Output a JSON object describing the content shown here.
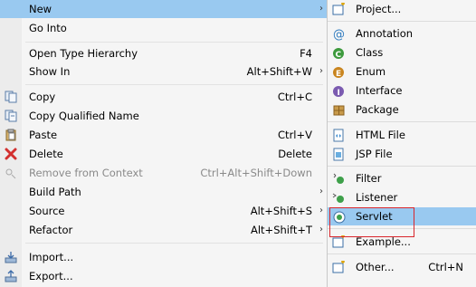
{
  "context_menu": {
    "items": [
      {
        "label": "New",
        "shortcut": "",
        "submenu": true,
        "highlighted": true
      },
      {
        "label": "Go Into",
        "shortcut": ""
      },
      {
        "label": "Open Type Hierarchy",
        "shortcut": "F4"
      },
      {
        "label": "Show In",
        "shortcut": "Alt+Shift+W",
        "submenu": true
      },
      {
        "label": "Copy",
        "shortcut": "Ctrl+C",
        "icon": "copy-icon"
      },
      {
        "label": "Copy Qualified Name",
        "shortcut": "",
        "icon": "copy-qualified-icon"
      },
      {
        "label": "Paste",
        "shortcut": "Ctrl+V",
        "icon": "paste-icon"
      },
      {
        "label": "Delete",
        "shortcut": "Delete",
        "icon": "delete-icon"
      },
      {
        "label": "Remove from Context",
        "shortcut": "Ctrl+Alt+Shift+Down",
        "icon": "remove-context-icon",
        "disabled": true
      },
      {
        "label": "Build Path",
        "shortcut": "",
        "submenu": true
      },
      {
        "label": "Source",
        "shortcut": "Alt+Shift+S",
        "submenu": true
      },
      {
        "label": "Refactor",
        "shortcut": "Alt+Shift+T",
        "submenu": true
      },
      {
        "label": "Import...",
        "shortcut": "",
        "icon": "import-icon"
      },
      {
        "label": "Export...",
        "shortcut": "",
        "icon": "export-icon"
      }
    ]
  },
  "new_submenu": {
    "items": [
      {
        "label": "Project...",
        "icon": "project-icon"
      },
      {
        "label": "Annotation",
        "icon": "annotation-icon"
      },
      {
        "label": "Class",
        "icon": "class-icon"
      },
      {
        "label": "Enum",
        "icon": "enum-icon"
      },
      {
        "label": "Interface",
        "icon": "interface-icon"
      },
      {
        "label": "Package",
        "icon": "package-icon"
      },
      {
        "label": "HTML File",
        "icon": "html-file-icon"
      },
      {
        "label": "JSP File",
        "icon": "jsp-file-icon"
      },
      {
        "label": "Filter",
        "icon": "filter-icon"
      },
      {
        "label": "Listener",
        "icon": "listener-icon"
      },
      {
        "label": "Servlet",
        "icon": "servlet-icon",
        "highlighted": true
      },
      {
        "label": "Example...",
        "icon": "example-icon"
      },
      {
        "label": "Other...",
        "shortcut": "Ctrl+N",
        "icon": "other-icon"
      }
    ]
  },
  "colors": {
    "highlight": "#99c9f0",
    "focus_box": "#d9262c"
  }
}
